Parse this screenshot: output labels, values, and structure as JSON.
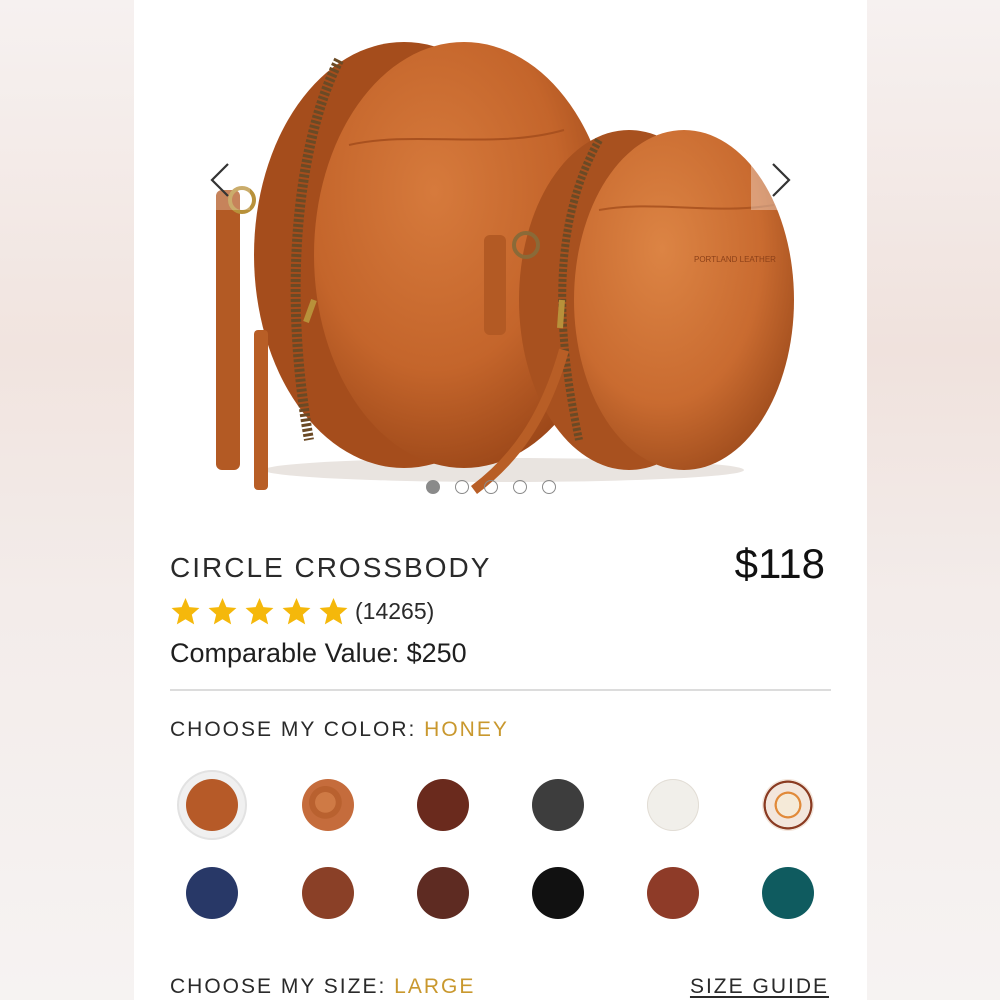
{
  "product": {
    "title": "CIRCLE CROSSBODY",
    "price": "$118",
    "rating_stars": 5,
    "review_count": "(14265)",
    "comparable_value": "Comparable Value: $250",
    "brand_stamp": "PORTLAND LEATHER"
  },
  "gallery": {
    "slide_count": 5,
    "active_slide": 1,
    "prev_icon": "chevron-left-icon",
    "next_icon": "chevron-right-icon"
  },
  "color": {
    "label": "CHOOSE MY COLOR:",
    "selected": "HONEY",
    "swatches": [
      {
        "name": "honey",
        "hex": "#b65a28"
      },
      {
        "name": "embossed-floral",
        "hex": "#c26a3a"
      },
      {
        "name": "cognac-dark",
        "hex": "#6a2a1d"
      },
      {
        "name": "charcoal",
        "hex": "#3d3d3d"
      },
      {
        "name": "bone",
        "hex": "#f1efea"
      },
      {
        "name": "floral-print",
        "hex": "#f3e6dc"
      },
      {
        "name": "navy",
        "hex": "#283867"
      },
      {
        "name": "nutmeg",
        "hex": "#8a4027"
      },
      {
        "name": "espresso",
        "hex": "#5e2b22"
      },
      {
        "name": "black",
        "hex": "#111111"
      },
      {
        "name": "cinnamon",
        "hex": "#8e3b28"
      },
      {
        "name": "teal",
        "hex": "#0f5b5f"
      }
    ]
  },
  "size": {
    "label": "CHOOSE MY SIZE:",
    "selected": "LARGE",
    "guide_label": "SIZE GUIDE"
  },
  "colors": {
    "accent": "#c9982e",
    "star": "#f5b80b",
    "leather": "#c8672e"
  }
}
